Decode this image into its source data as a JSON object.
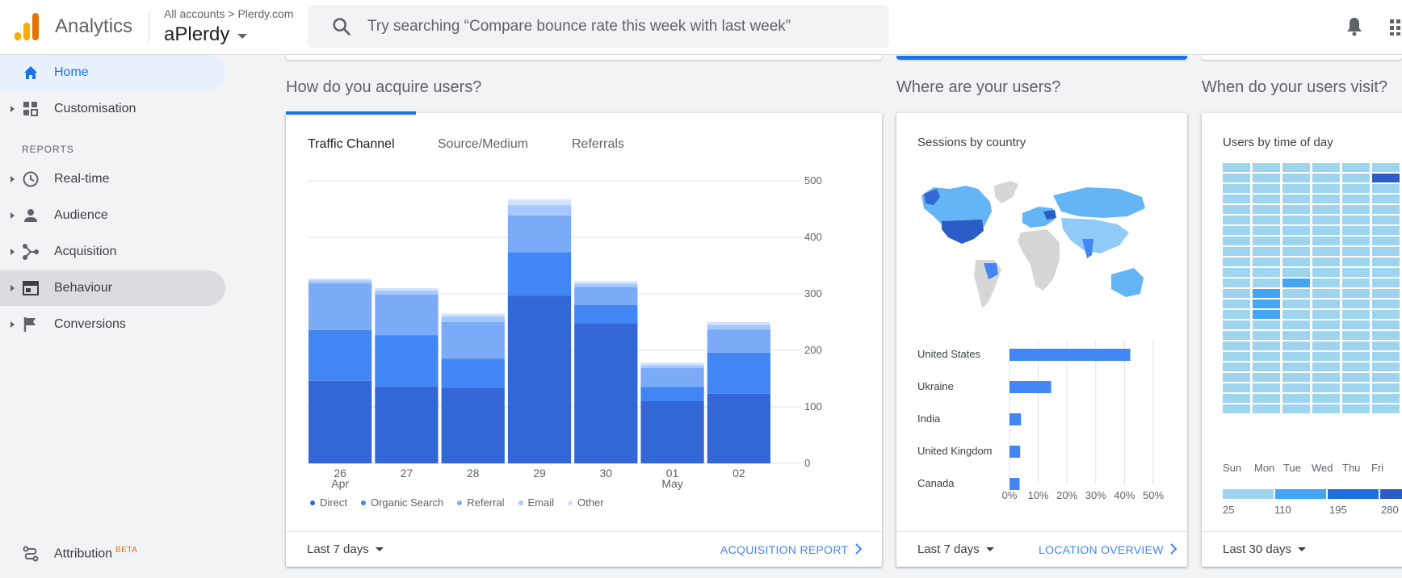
{
  "header": {
    "brand": "Analytics",
    "breadcrumb": "All accounts > Plerdy.com",
    "account": "aPlerdy",
    "search_placeholder": "Try searching “Compare bounce rate this week with last week”"
  },
  "sidebar": {
    "home": "Home",
    "customisation": "Customisation",
    "reports_label": "REPORTS",
    "items": [
      "Real-time",
      "Audience",
      "Acquisition",
      "Behaviour",
      "Conversions"
    ],
    "attribution": "Attribution",
    "attribution_badge": "BETA"
  },
  "acquire": {
    "title": "How do you acquire users?",
    "tabs": [
      "Traffic Channel",
      "Source/Medium",
      "Referrals"
    ],
    "legend": [
      "Direct",
      "Organic Search",
      "Referral",
      "Email",
      "Other"
    ],
    "date_range": "Last 7 days",
    "report_link": "ACQUISITION REPORT"
  },
  "where": {
    "title": "Where are your users?",
    "subtitle": "Sessions by country",
    "date_range": "Last 7 days",
    "report_link": "LOCATION OVERVIEW"
  },
  "when": {
    "title": "When do your users visit?",
    "subtitle": "Users by time of day",
    "days": [
      "Sun",
      "Mon",
      "Tue",
      "Wed",
      "Thu",
      "Fri"
    ],
    "scale": [
      "25",
      "110",
      "195",
      "280"
    ],
    "date_range": "Last 30 days"
  },
  "colors": {
    "direct": "#3367d6",
    "organic": "#4285f4",
    "referral": "#7baaf7",
    "email": "#a6c8ff",
    "other": "#d2e3fc",
    "accent": "#1a73e8"
  },
  "chart_data": [
    {
      "type": "bar",
      "stacked": true,
      "categories": [
        "26 Apr",
        "27",
        "28",
        "29",
        "30",
        "01 May",
        "02"
      ],
      "series": [
        {
          "name": "Direct",
          "values": [
            146,
            136,
            134,
            297,
            248,
            110,
            123
          ]
        },
        {
          "name": "Organic Search",
          "values": [
            90,
            91,
            51,
            77,
            32,
            25,
            73
          ]
        },
        {
          "name": "Referral",
          "values": [
            83,
            72,
            65,
            65,
            32,
            34,
            41
          ]
        },
        {
          "name": "Email",
          "values": [
            5,
            7,
            10,
            18,
            6,
            5,
            8
          ]
        },
        {
          "name": "Other",
          "values": [
            3,
            4,
            5,
            10,
            4,
            4,
            5
          ]
        }
      ],
      "ylim": [
        0,
        500
      ],
      "yticks": [
        "0",
        "100",
        "200",
        "300",
        "400",
        "500"
      ],
      "grid": true,
      "legend": "bottom"
    },
    {
      "type": "bar",
      "orientation": "horizontal",
      "categories": [
        "United States",
        "Ukraine",
        "India",
        "United Kingdom",
        "Canada"
      ],
      "values": [
        42,
        14.5,
        4,
        3.7,
        3.5
      ],
      "xlim": [
        0,
        50
      ],
      "xticks": [
        "0%",
        "10%",
        "20%",
        "30%",
        "40%",
        "50%"
      ],
      "grid": true
    }
  ]
}
